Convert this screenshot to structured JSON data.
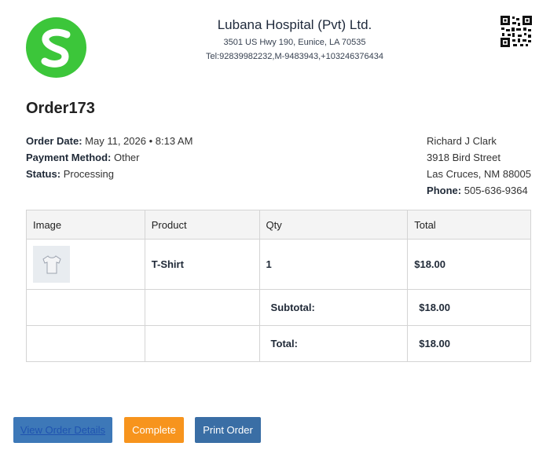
{
  "company": {
    "name": "Lubana Hospital (Pvt) Ltd.",
    "address": "3501 US Hwy 190, Eunice, LA 70535",
    "tel": "Tel:92839982232,M-9483943,+103246376434",
    "brand_color": "#3cc63a"
  },
  "order": {
    "title": "Order173",
    "date_label": "Order Date:",
    "date_value": "May 11, 2026 • 8:13 AM",
    "payment_label": "Payment Method:",
    "payment_value": "Other",
    "status_label": "Status:",
    "status_value": "Processing"
  },
  "customer": {
    "name": "Richard J Clark",
    "street": "3918 Bird Street",
    "city": "Las Cruces, NM 88005",
    "phone_label": "Phone:",
    "phone_value": "505-636-9364"
  },
  "table": {
    "headers": [
      "Image",
      "Product",
      "Qty",
      "Total"
    ],
    "items": [
      {
        "image_icon": "tshirt-icon",
        "product": "T-Shirt",
        "qty": "1",
        "total": "$18.00"
      }
    ],
    "subtotal_label": "Subtotal:",
    "subtotal_value": "$18.00",
    "total_label": "Total:",
    "total_value": "$18.00"
  },
  "buttons": {
    "view": "View Order Details",
    "complete": "Complete",
    "print": "Print Order"
  },
  "colors": {
    "view_button": "#3d78b8",
    "complete_button": "#f7941d",
    "print_button": "#3a6ea5"
  }
}
